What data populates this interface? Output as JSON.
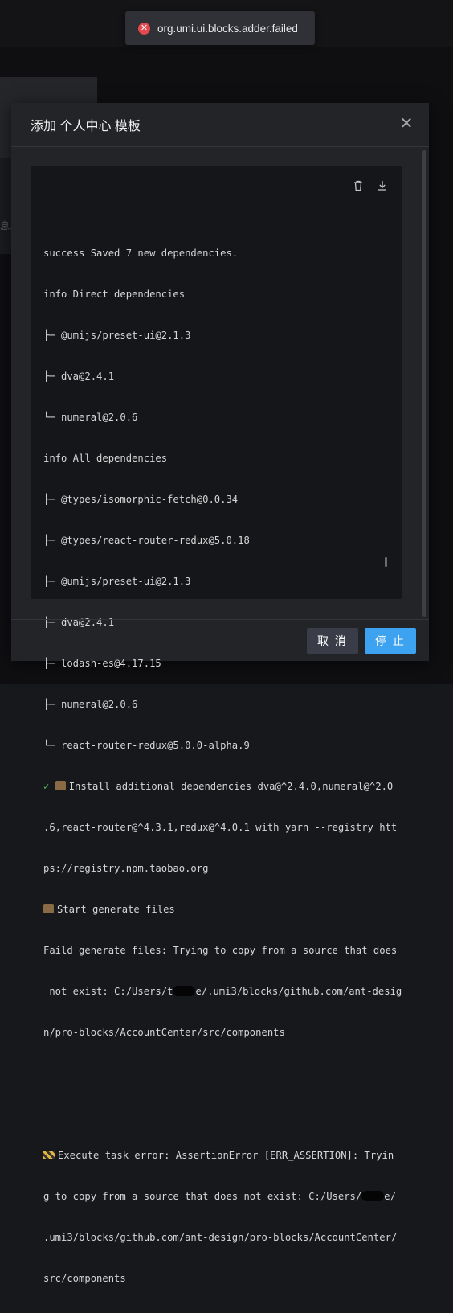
{
  "toast": {
    "text": "org.umi.ui.blocks.adder.failed",
    "icon": "error-circle-icon",
    "color": "#e5484d"
  },
  "background": {
    "fragment": "息。"
  },
  "modal": {
    "title": "添加 个人中心 模板",
    "close_icon": "close-icon",
    "terminal": {
      "actions": [
        {
          "name": "clear-icon",
          "label": "clear"
        },
        {
          "name": "download-icon",
          "label": "download"
        }
      ],
      "lines": [
        "success Saved 7 new dependencies.",
        "info Direct dependencies",
        "├─ @umijs/preset-ui@2.1.3",
        "├─ dva@2.4.1",
        "└─ numeral@2.0.6",
        "info All dependencies",
        "├─ @types/isomorphic-fetch@0.0.34",
        "├─ @types/react-router-redux@5.0.18",
        "├─ @umijs/preset-ui@2.1.3",
        "├─ dva@2.4.1",
        "├─ lodash-es@4.17.15",
        "├─ numeral@2.0.6",
        "└─ react-router-redux@5.0.0-alpha.9",
        "✓",
        "Install additional dependencies dva@^2.4.0,numeral@^2.0",
        ".6,react-router@^4.3.1,redux@^4.0.1 with yarn --registry htt",
        "ps://registry.npm.taobao.org",
        "Start generate files",
        "Faild generate files: Trying to copy from a source that does",
        " not exist: C:/Users/t",
        "e/.umi3/blocks/github.com/ant-desig",
        "n/pro-blocks/AccountCenter/src/components",
        "Execute task error: AssertionError [ERR_ASSERTION]: Tryin",
        "g to copy from a source that does not exist: C:/Users/",
        "e/",
        ".umi3/blocks/github.com/ant-design/pro-blocks/AccountCenter/",
        "src/components"
      ]
    },
    "footer": {
      "cancel_label": "取 消",
      "stop_label": "停 止"
    }
  },
  "colors": {
    "accent": "#3da2ef",
    "success": "#4fbd5c",
    "error": "#e5484d",
    "background": "#17181c",
    "terminal_bg": "#151619"
  }
}
